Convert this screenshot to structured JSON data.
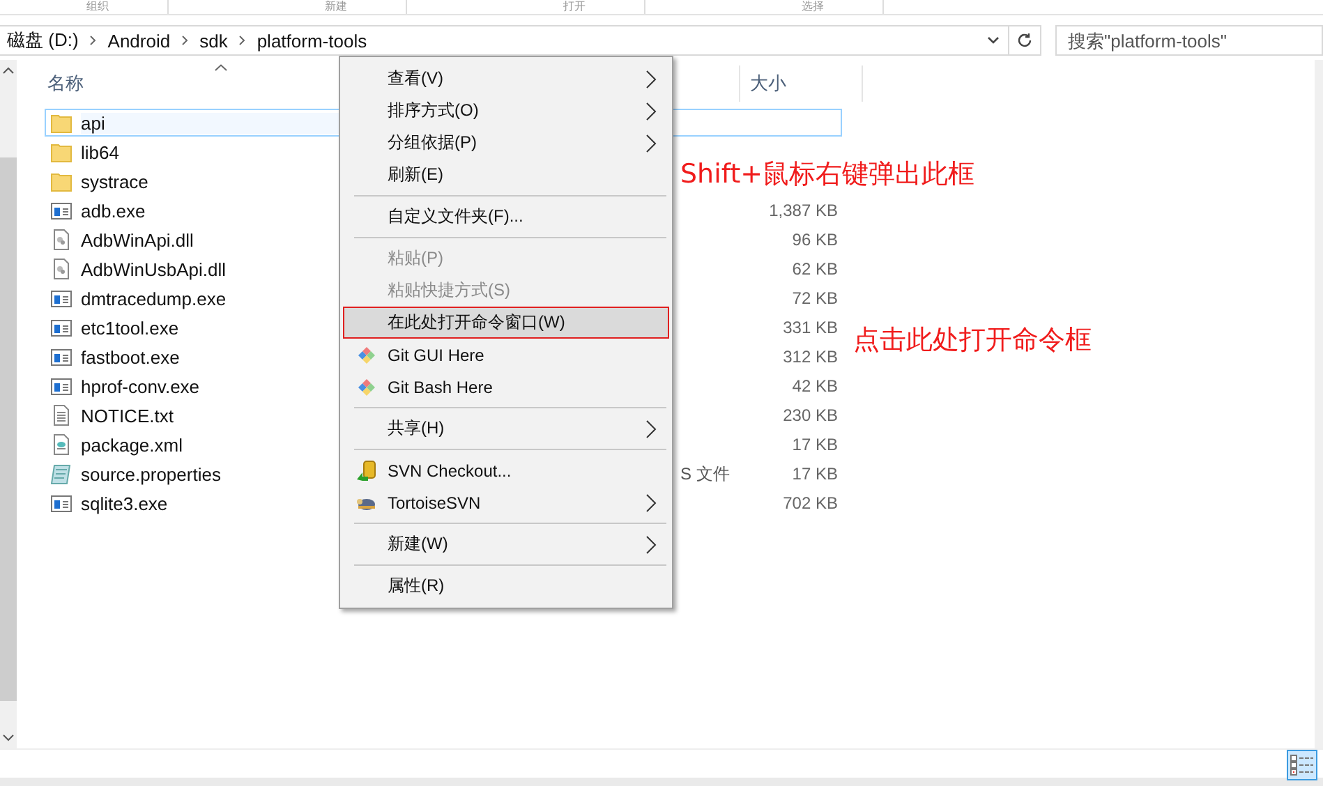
{
  "ribbon_groups": [
    "组织",
    "新建",
    "打开",
    "选择"
  ],
  "address_bar": {
    "segments": [
      "磁盘 (D:)",
      "Android",
      "sdk",
      "platform-tools"
    ]
  },
  "search": {
    "placeholder": "搜索\"platform-tools\""
  },
  "columns": [
    {
      "label": "名称",
      "sorted": true
    },
    {
      "label": "大小",
      "sorted": false
    }
  ],
  "files": [
    {
      "name": "api",
      "kind": "folder",
      "selected": true
    },
    {
      "name": "lib64",
      "kind": "folder",
      "selected": false
    },
    {
      "name": "systrace",
      "kind": "folder",
      "selected": false
    },
    {
      "name": "adb.exe",
      "kind": "exe",
      "size": "1,387 KB",
      "selected": false
    },
    {
      "name": "AdbWinApi.dll",
      "kind": "dll",
      "size": "96 KB",
      "selected": false
    },
    {
      "name": "AdbWinUsbApi.dll",
      "kind": "dll",
      "size": "62 KB",
      "selected": false
    },
    {
      "name": "dmtracedump.exe",
      "kind": "exe",
      "size": "72 KB",
      "selected": false
    },
    {
      "name": "etc1tool.exe",
      "kind": "exe",
      "size": "331 KB",
      "selected": false
    },
    {
      "name": "fastboot.exe",
      "kind": "exe",
      "size": "312 KB",
      "selected": false
    },
    {
      "name": "hprof-conv.exe",
      "kind": "exe",
      "size": "42 KB",
      "selected": false
    },
    {
      "name": "NOTICE.txt",
      "kind": "txt",
      "size": "230 KB",
      "selected": false
    },
    {
      "name": "package.xml",
      "kind": "xml",
      "size": "17 KB",
      "selected": false
    },
    {
      "name": "source.properties",
      "kind": "props",
      "type": "S 文件",
      "size": "17 KB",
      "selected": false
    },
    {
      "name": "sqlite3.exe",
      "kind": "exe",
      "size": "702 KB",
      "selected": false
    }
  ],
  "context_menu": [
    {
      "kind": "item",
      "label": "查看(V)",
      "submenu": true,
      "disabled": false,
      "selected": false
    },
    {
      "kind": "item",
      "label": "排序方式(O)",
      "submenu": true,
      "disabled": false,
      "selected": false
    },
    {
      "kind": "item",
      "label": "分组依据(P)",
      "submenu": true,
      "disabled": false,
      "selected": false
    },
    {
      "kind": "item",
      "label": "刷新(E)",
      "submenu": false,
      "disabled": false,
      "selected": false
    },
    {
      "kind": "separator"
    },
    {
      "kind": "item",
      "label": "自定义文件夹(F)...",
      "submenu": false,
      "disabled": false,
      "selected": false
    },
    {
      "kind": "separator"
    },
    {
      "kind": "item",
      "label": "粘贴(P)",
      "submenu": false,
      "disabled": true,
      "selected": false
    },
    {
      "kind": "item",
      "label": "粘贴快捷方式(S)",
      "submenu": false,
      "disabled": true,
      "selected": false
    },
    {
      "kind": "item",
      "label": "在此处打开命令窗口(W)",
      "submenu": false,
      "disabled": false,
      "selected": true
    },
    {
      "kind": "item",
      "label": "Git GUI Here",
      "submenu": false,
      "disabled": false,
      "selected": false
    },
    {
      "kind": "item",
      "label": "Git Bash Here",
      "submenu": false,
      "disabled": false,
      "selected": false
    },
    {
      "kind": "separator"
    },
    {
      "kind": "item",
      "label": "共享(H)",
      "submenu": true,
      "disabled": false,
      "selected": false
    },
    {
      "kind": "separator"
    },
    {
      "kind": "item",
      "label": "SVN Checkout...",
      "submenu": false,
      "disabled": false,
      "selected": false
    },
    {
      "kind": "item",
      "label": "TortoiseSVN",
      "submenu": true,
      "disabled": false,
      "selected": false
    },
    {
      "kind": "separator"
    },
    {
      "kind": "item",
      "label": "新建(W)",
      "submenu": true,
      "disabled": false,
      "selected": false
    },
    {
      "kind": "separator"
    },
    {
      "kind": "item",
      "label": "属性(R)",
      "submenu": false,
      "disabled": false,
      "selected": false
    }
  ],
  "annotations": [
    {
      "text": "Shift+鼠标右键弹出此框"
    },
    {
      "text": "点击此处打开命令框"
    }
  ]
}
